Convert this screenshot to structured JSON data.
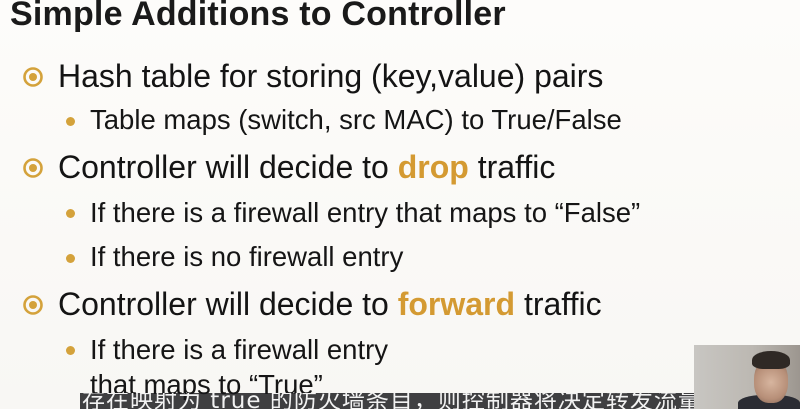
{
  "slide": {
    "title": "Simple Additions to Controller",
    "bullets": [
      {
        "text": "Hash table for storing (key,value) pairs",
        "sub": [
          "Table maps (switch, src MAC) to True/False"
        ]
      },
      {
        "pre": "Controller will decide to ",
        "keyword": "drop",
        "post": " traffic",
        "sub": [
          "If there is a firewall entry that maps to “False”",
          "If there is no firewall entry"
        ]
      },
      {
        "pre": "Controller will decide to ",
        "keyword": "forward",
        "post": " traffic",
        "sub": [
          "If there is a firewall entry",
          "that maps to “True”"
        ]
      }
    ]
  },
  "subtitle": {
    "text": "存在映射为 true 的防火墙条目，则控制器将决定转发流量"
  },
  "colors": {
    "accent": "#d49a32",
    "bullet_dot": "#d4a23b"
  },
  "icons": {
    "level1": "circle-bullet-icon",
    "level2": "dot-bullet-icon"
  }
}
